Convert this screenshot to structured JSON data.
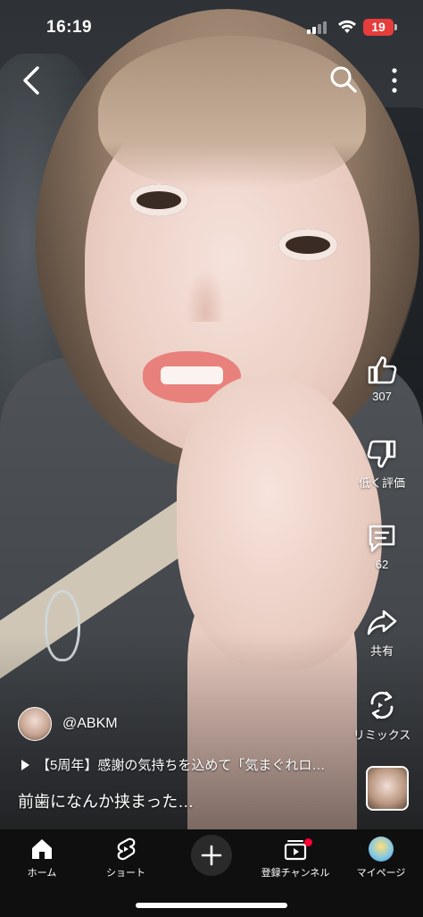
{
  "status_bar": {
    "time": "16:19",
    "battery": "19"
  },
  "top_bar": {
    "back_icon": "chevron-left-icon",
    "search_icon": "search-icon",
    "more_icon": "more-vert-icon"
  },
  "actions": {
    "like_count": "307",
    "dislike_label": "低く評価",
    "comment_count": "62",
    "share_label": "共有",
    "remix_label": "リミックス"
  },
  "video": {
    "channel_handle": "@ABKM",
    "playlist_title": "【5周年】感謝の気持ちを込めて「気まぐれロ…",
    "caption": "前歯になんか挟まった…"
  },
  "navbar": {
    "items": [
      {
        "label": "ホーム",
        "icon": "home-icon"
      },
      {
        "label": "ショート",
        "icon": "shorts-icon"
      },
      {
        "label": "",
        "icon": "plus-icon"
      },
      {
        "label": "登録チャンネル",
        "icon": "subscriptions-icon"
      },
      {
        "label": "マイページ",
        "icon": "avatar"
      }
    ]
  },
  "colors": {
    "battery_low": "#e63c3c",
    "notification_dot": "#ff0033",
    "nav_background": "#0f0f0f"
  }
}
